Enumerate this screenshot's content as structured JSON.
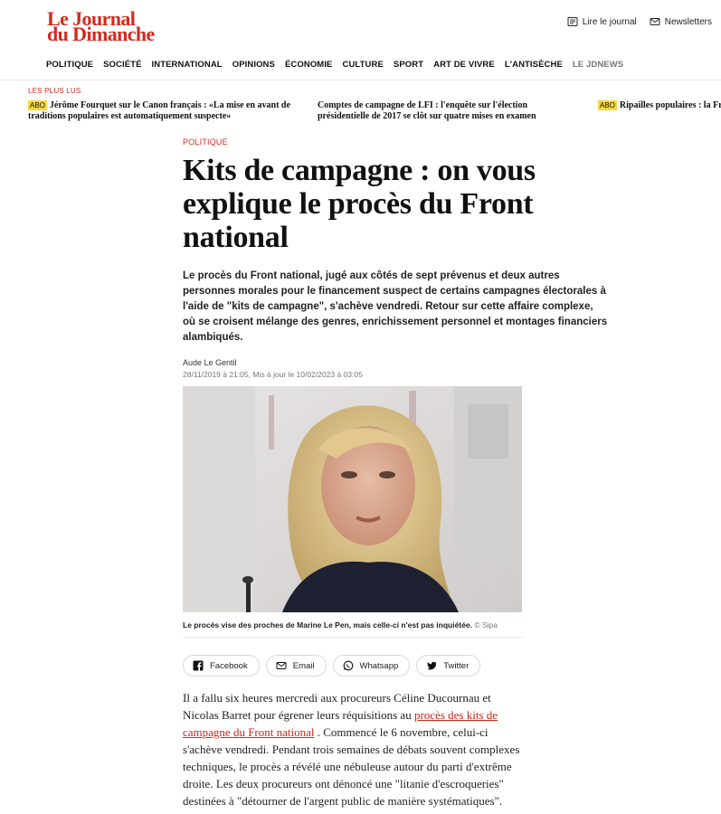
{
  "logo": {
    "line1": "Le Journal",
    "line2": "du Dimanche"
  },
  "header_actions": [
    {
      "label": "Lire le journal",
      "icon": "newspaper-icon"
    },
    {
      "label": "Newsletters",
      "icon": "mail-icon"
    }
  ],
  "nav": [
    "POLITIQUE",
    "SOCIÉTÉ",
    "INTERNATIONAL",
    "OPINIONS",
    "ÉCONOMIE",
    "CULTURE",
    "SPORT",
    "ART DE VIVRE",
    "L'ANTISÈCHE",
    "LE JDNEWS"
  ],
  "plus_lus": {
    "label": "LES PLUS LUS",
    "items": [
      {
        "abo": "ABO",
        "text": "Jérôme Fourquet sur le Canon français : «La mise en avant de traditions populaires est automatiquement suspecte»"
      },
      {
        "abo": "",
        "text": "Comptes de campagne de LFI : l'enquête sur l'élection présidentielle de 2017 se clôt sur quatre mises en examen"
      },
      {
        "abo": "ABO",
        "text": "Ripailles populaires : la France"
      }
    ]
  },
  "article": {
    "category": "POLITIQUE",
    "title": "Kits de campagne : on vous explique le procès du Front national",
    "lead": "Le procès du Front national, jugé aux côtés de sept prévenus et deux autres personnes morales pour le financement suspect de certains campagnes électorales à l'aide de \"kits de campagne\", s'achève vendredi. Retour sur cette affaire complexe, où se croisent mélange des genres, enrichissement personnel et montages financiers alambiqués.",
    "author": "Aude Le Gentil",
    "dates": "28/11/2019 à 21:05, Mis à jour le 10/02/2023 à 03:05",
    "caption": "Le procès vise des proches de Marine Le Pen, mais celle-ci n'est pas inquiétée.",
    "credit": "© Sipa",
    "share": [
      {
        "label": "Facebook",
        "icon": "facebook-icon"
      },
      {
        "label": "Email",
        "icon": "mail-icon"
      },
      {
        "label": "Whatsapp",
        "icon": "whatsapp-icon"
      },
      {
        "label": "Twitter",
        "icon": "twitter-icon"
      }
    ],
    "body_before_link": "Il a fallu six heures mercredi aux procureurs Céline Ducournau et Nicolas Barret pour égrener leurs réquisitions au ",
    "body_link": "procès des kits de campagne du Front national",
    "body_after_link": " . Commencé le 6 novembre, celui-ci s'achève vendredi. Pendant trois semaines de débats souvent complexes techniques, le procès a révélé une nébuleuse autour du parti d'extrême droite. Les deux procureurs ont dénoncé une \"litanie d'escroqueries\" destinées à \"détourner de l'argent public de manière systématiques\". Avant la fin des plaidoiries des avocats, retour sur une"
  },
  "colors": {
    "brand": "#d42a1f",
    "abo_badge": "#f7d63a",
    "link": "#c8261b"
  }
}
